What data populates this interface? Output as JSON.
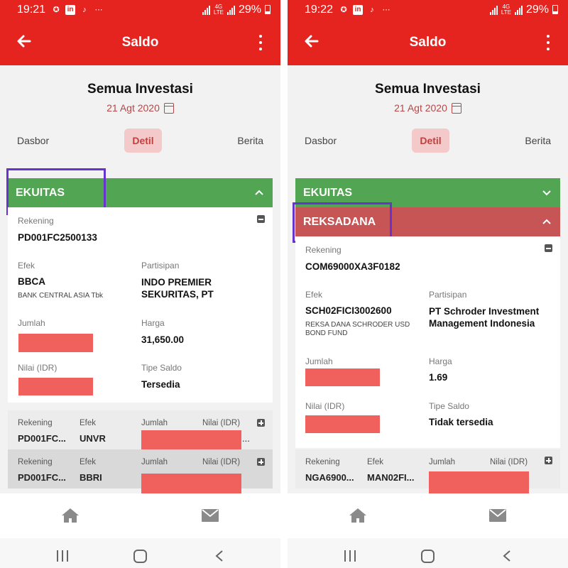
{
  "screens": [
    {
      "status": {
        "time": "19:21",
        "battery": "29%",
        "network": "4G",
        "network_sub": "LTE"
      },
      "appbar": {
        "title": "Saldo"
      },
      "header": {
        "title": "Semua Investasi",
        "date": "21 Agt 2020"
      },
      "tabs": [
        "Dasbor",
        "Detil",
        "Berita"
      ],
      "sections": [
        {
          "label": "EKUITAS",
          "state": "expanded",
          "color": "#52a552"
        }
      ],
      "detail": {
        "rekening_label": "Rekening",
        "rekening": "PD001FC2500133",
        "efek_label": "Efek",
        "efek": "BBCA",
        "efek_desc": "BANK CENTRAL ASIA Tbk",
        "partisipan_label": "Partisipan",
        "partisipan": "INDO PREMIER SEKURITAS, PT",
        "jumlah_label": "Jumlah",
        "harga_label": "Harga",
        "harga": "31,650.00",
        "nilai_label": "Nilai (IDR)",
        "tipe_label": "Tipe Saldo",
        "tipe": "Tersedia"
      },
      "rows": [
        {
          "rek_label": "Rekening",
          "rek": "PD001FC...",
          "efek_label": "Efek",
          "efek": "UNVR",
          "jumlah_label": "Jumlah",
          "nilai_label": "Nilai (IDR)",
          "nilai_tail": "..."
        },
        {
          "rek_label": "Rekening",
          "rek": "PD001FC...",
          "efek_label": "Efek",
          "efek": "BBRI",
          "jumlah_label": "Jumlah",
          "nilai_label": "Nilai (IDR)",
          "nilai_tail": "..."
        }
      ]
    },
    {
      "status": {
        "time": "19:22",
        "battery": "29%",
        "network": "4G",
        "network_sub": "LTE"
      },
      "appbar": {
        "title": "Saldo"
      },
      "header": {
        "title": "Semua Investasi",
        "date": "21 Agt 2020"
      },
      "tabs": [
        "Dasbor",
        "Detil",
        "Berita"
      ],
      "sections": [
        {
          "label": "EKUITAS",
          "state": "collapsed",
          "color": "#52a552"
        },
        {
          "label": "REKSADANA",
          "state": "expanded",
          "color": "#c85555"
        }
      ],
      "detail": {
        "rekening_label": "Rekening",
        "rekening": "COM69000XA3F0182",
        "efek_label": "Efek",
        "efek": "SCH02FICI3002600",
        "efek_desc": "REKSA DANA SCHRODER USD BOND FUND",
        "partisipan_label": "Partisipan",
        "partisipan": "PT Schroder Investment Management Indonesia",
        "jumlah_label": "Jumlah",
        "harga_label": "Harga",
        "harga": "1.69",
        "nilai_label": "Nilai (IDR)",
        "tipe_label": "Tipe Saldo",
        "tipe": "Tidak tersedia"
      },
      "rows": [
        {
          "rek_label": "Rekening",
          "rek": "NGA6900...",
          "efek_label": "Efek",
          "efek": "MAN02FI...",
          "jumlah_label": "Jumlah",
          "nilai_label": "Nilai (IDR)",
          "nilai_tail": ""
        }
      ]
    }
  ],
  "colors": {
    "brand_red": "#e52420",
    "equity_green": "#52a552",
    "fund_red": "#c85555",
    "highlight": "#6633cc",
    "redaction": "#f0605c",
    "date_red": "#b54848"
  },
  "icons": [
    "back-arrow-icon",
    "kebab-menu-icon",
    "calendar-icon",
    "chevron-up-icon",
    "chevron-down-icon",
    "minus-box-icon",
    "plus-box-icon",
    "home-icon",
    "mail-icon",
    "recent-apps-icon",
    "system-home-icon",
    "system-back-icon"
  ]
}
